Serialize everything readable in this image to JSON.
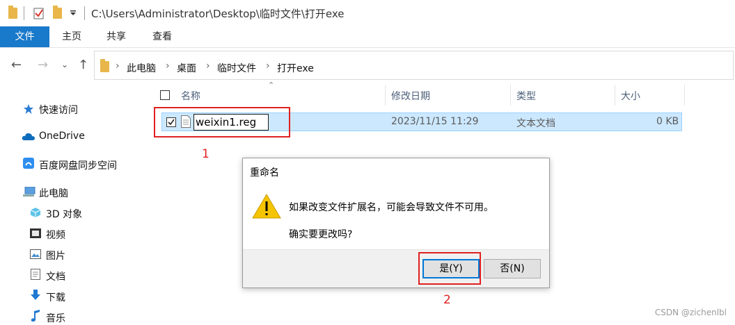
{
  "titlebar": {
    "path": "C:\\Users\\Administrator\\Desktop\\临时文件\\打开exe",
    "icons": [
      "folder-icon",
      "properties-checkbox-icon",
      "new-folder-icon",
      "customize-dropdown-icon"
    ]
  },
  "ribbon": {
    "tabs": [
      {
        "label": "文件",
        "active": true
      },
      {
        "label": "主页"
      },
      {
        "label": "共享"
      },
      {
        "label": "查看"
      }
    ]
  },
  "address": {
    "crumbs": [
      "此电脑",
      "桌面",
      "临时文件",
      "打开exe"
    ]
  },
  "nav_pane": {
    "items": [
      {
        "label": "快速访问",
        "icon": "star-icon"
      },
      {
        "label": "OneDrive",
        "icon": "cloud-icon"
      },
      {
        "label": "百度网盘同步空间",
        "icon": "baidu-netdisk-icon"
      },
      {
        "label": "此电脑",
        "icon": "computer-icon"
      },
      {
        "label": "3D 对象",
        "icon": "cube-3d-icon"
      },
      {
        "label": "视频",
        "icon": "video-icon"
      },
      {
        "label": "图片",
        "icon": "picture-icon"
      },
      {
        "label": "文档",
        "icon": "document-icon"
      },
      {
        "label": "下载",
        "icon": "download-arrow-icon"
      },
      {
        "label": "音乐",
        "icon": "music-note-icon"
      }
    ]
  },
  "file_list": {
    "columns": [
      "名称",
      "修改日期",
      "类型",
      "大小"
    ],
    "rows": [
      {
        "name": "weixin1.reg",
        "modified": "2023/11/15 11:29",
        "type": "文本文档",
        "size": "0 KB",
        "selected": true
      }
    ]
  },
  "annotations": {
    "label1": "1",
    "label2": "2",
    "color": "#e02020"
  },
  "dialog": {
    "title": "重命名",
    "message": "如果改变文件扩展名，可能会导致文件不可用。",
    "question": "确实要更改吗?",
    "yes": "是(Y)",
    "no": "否(N)",
    "icon": "warning-icon"
  },
  "watermark": "CSDN @zichenlbl",
  "colors": {
    "accent": "#1979ca",
    "selection": "#cce8ff",
    "warning": "#f5c400"
  }
}
